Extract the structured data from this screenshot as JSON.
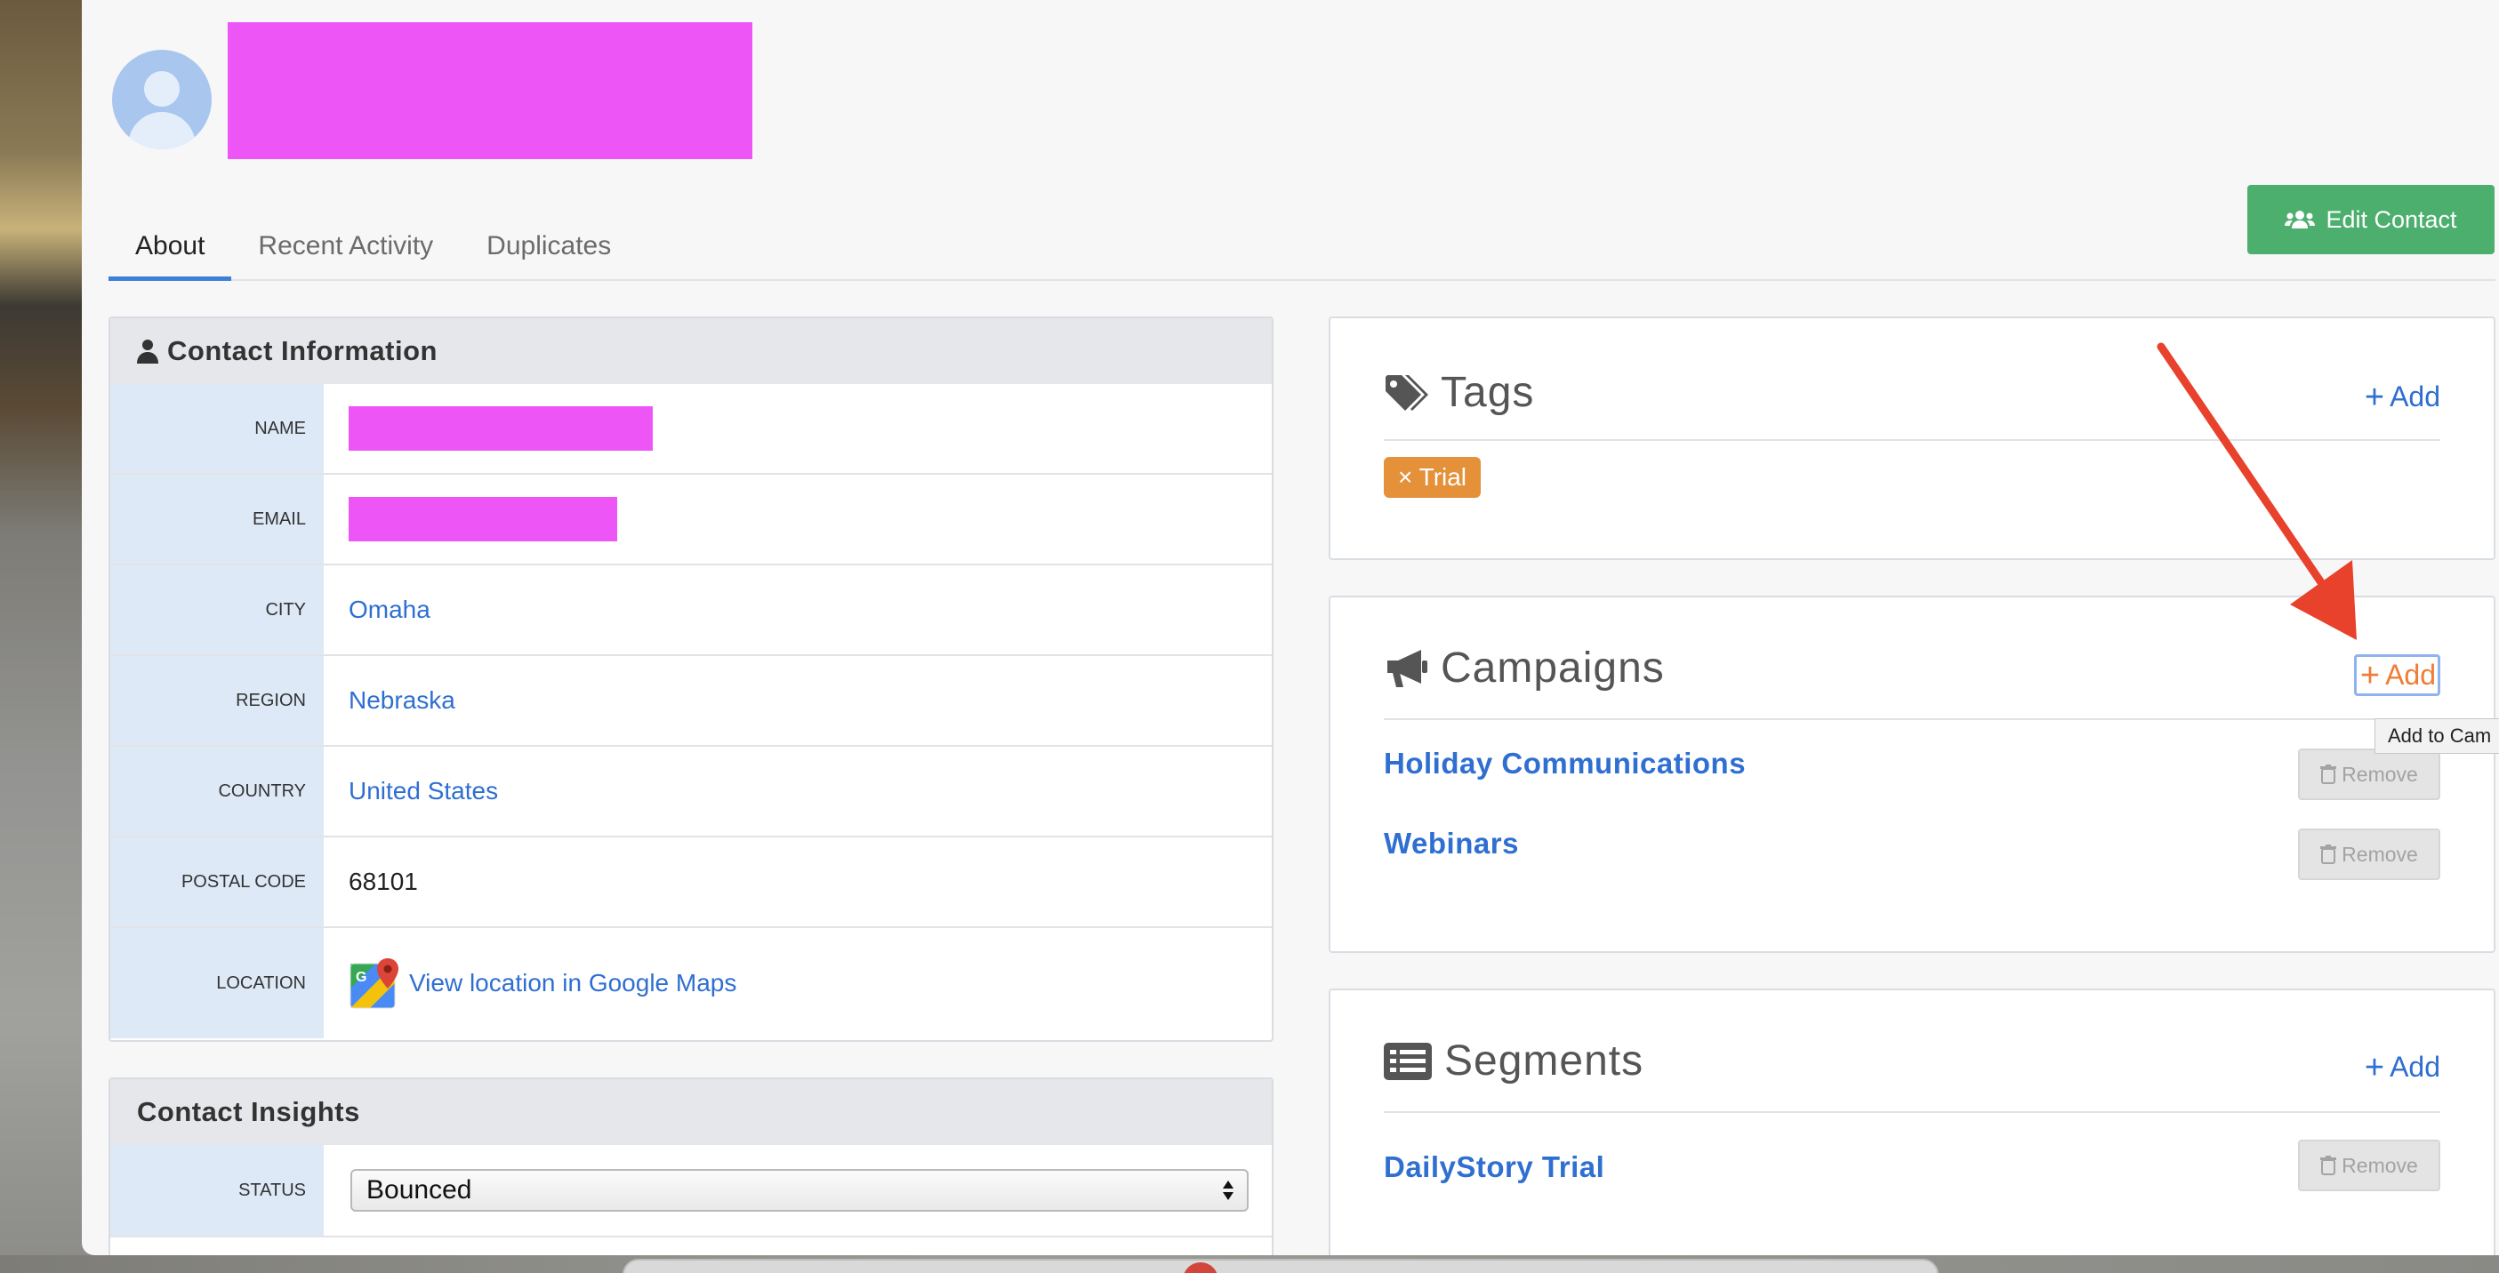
{
  "tabs": [
    "About",
    "Recent Activity",
    "Duplicates"
  ],
  "edit_contact_label": "Edit Contact",
  "contact_info": {
    "title": "Contact Information",
    "rows": [
      {
        "label": "NAME",
        "value": ""
      },
      {
        "label": "EMAIL",
        "value": ""
      },
      {
        "label": "CITY",
        "value": "Omaha"
      },
      {
        "label": "REGION",
        "value": "Nebraska"
      },
      {
        "label": "COUNTRY",
        "value": "United States"
      },
      {
        "label": "POSTAL CODE",
        "value": "68101"
      },
      {
        "label": "LOCATION",
        "value": "View location in Google Maps"
      }
    ]
  },
  "insights": {
    "title": "Contact Insights",
    "status_label": "STATUS",
    "status_value": "Bounced"
  },
  "tags": {
    "title": "Tags",
    "add_label": "Add",
    "items": [
      "× Trial"
    ]
  },
  "campaigns": {
    "title": "Campaigns",
    "add_label": "Add",
    "tooltip": "Add to Cam",
    "items": [
      "Holiday Communications",
      "Webinars"
    ],
    "remove_label": "Remove"
  },
  "segments": {
    "title": "Segments",
    "add_label": "Add",
    "items": [
      "DailyStory Trial"
    ],
    "remove_label": "Remove"
  },
  "colors": {
    "accent": "#2f6fd1",
    "edit_button": "#4caf6e",
    "tag": "#e4913a",
    "annotation_arrow": "#e8412c",
    "redaction": "#ee55f6"
  }
}
